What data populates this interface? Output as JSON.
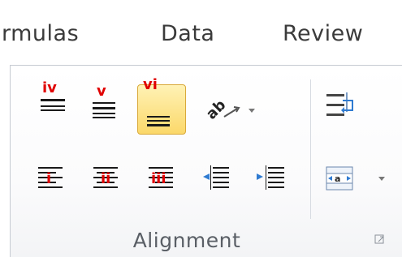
{
  "tabs": [
    {
      "label": "rmulas"
    },
    {
      "label": "Data"
    },
    {
      "label": "Review"
    }
  ],
  "group": {
    "label": "Alignment"
  },
  "annotations": {
    "top_align": "iv",
    "middle_align": "v",
    "bottom_align": "vi",
    "align_left": "i",
    "center": "ii",
    "align_right": "iii"
  },
  "colors": {
    "annotation": "#e00000",
    "active_highlight": "#fbd86a",
    "icon_lines": "#1a1a1a",
    "indent_arrow": "#2f7bd1"
  },
  "icons": [
    "orientation-icon",
    "wrap-text-icon",
    "merge-center-icon",
    "dialog-launcher-icon"
  ]
}
